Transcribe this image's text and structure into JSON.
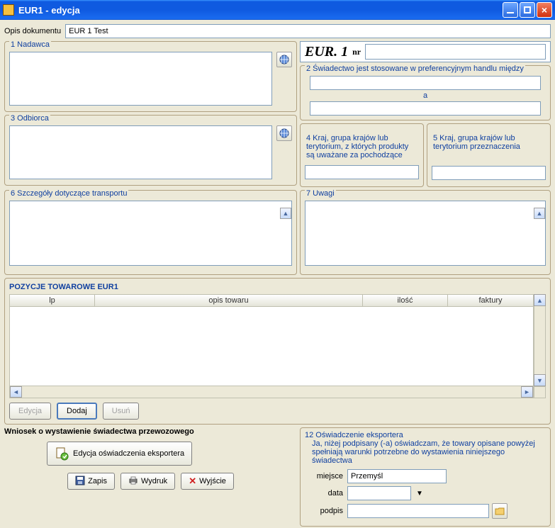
{
  "window": {
    "title": "EUR1 - edycja"
  },
  "opis": {
    "label": "Opis dokumentu",
    "value": "EUR 1 Test"
  },
  "box1": {
    "label": "1  Nadawca",
    "value": ""
  },
  "box3": {
    "label": "3  Odbiorca",
    "value": ""
  },
  "eur_header": {
    "big": "EUR. 1",
    "nr_label": "nr",
    "nr_value": ""
  },
  "box2": {
    "label": "2  Świadectwo jest stosowane w preferencyjnym handlu między",
    "value1": "",
    "sep": "a",
    "value2": ""
  },
  "box4": {
    "label": "4  Kraj, grupa krajów lub terytorium, z których produkty są uważane za pochodzące",
    "value": ""
  },
  "box5": {
    "label": "5  Kraj, grupa krajów lub terytorium przeznaczenia",
    "value": ""
  },
  "box6": {
    "label": "6  Szczegóły dotyczące transportu",
    "value": ""
  },
  "box7": {
    "label": "7  Uwagi",
    "value": ""
  },
  "pozycje": {
    "title": "POZYCJE TOWAROWE EUR1",
    "cols": {
      "lp": "lp",
      "opis": "opis towaru",
      "ilosc": "ilość",
      "faktury": "faktury"
    },
    "rows": []
  },
  "rowbtns": {
    "edycja": "Edycja",
    "dodaj": "Dodaj",
    "usun": "Usuń"
  },
  "wniosek": {
    "title": "Wniosek o wystawienie świadectwa przewozowego",
    "edit_btn": "Edycja oświadczenia eksportera"
  },
  "box12": {
    "label": "12  Oświadczenie eksportera",
    "desc": "Ja, niżej podpisany (-a) oświadczam, że towary opisane powyżej spełniają warunki potrzebne do wystawienia niniejszego świadectwa",
    "miejsce_label": "miejsce",
    "miejsce_value": "Przemyśl",
    "data_label": "data",
    "data_value": "",
    "podpis_label": "podpis",
    "podpis_value": ""
  },
  "footer": {
    "zapis": "Zapis",
    "wydruk": "Wydruk",
    "wyjscie": "Wyjście"
  }
}
